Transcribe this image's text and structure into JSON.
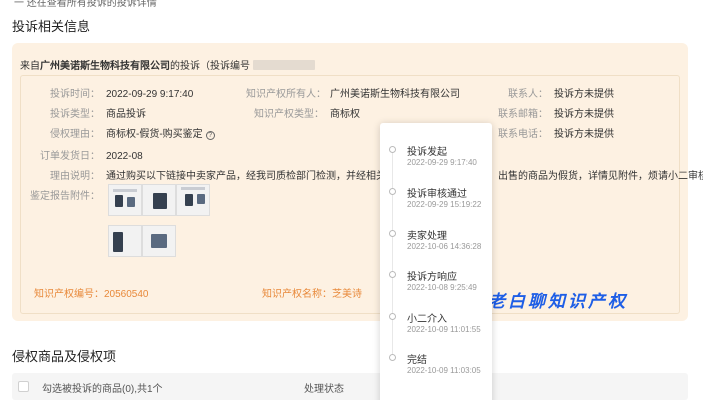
{
  "top_crumb": "一 还在查看所有投诉的投诉详情",
  "section1_title": "投诉相关信息",
  "card": {
    "head_prefix": "来自",
    "company": "广州美诺斯生物科技有限公司",
    "head_suffix": "的投诉（投诉编号",
    "rows": {
      "complaint_time_label": "投诉时间：",
      "complaint_time_value": "2022-09-29 9:17:40",
      "owner_label": "知识产权所有人：",
      "owner_value": "广州美诺斯生物科技有限公司",
      "contact_label": "联系人：",
      "contact_value": "投诉方未提供",
      "type_label": "投诉类型：",
      "type_value": "商品投诉",
      "ip_type_label": "知识产权类型：",
      "ip_type_value": "商标权",
      "email_label": "联系邮箱：",
      "email_value": "投诉方未提供",
      "reason_label": "侵权理由：",
      "reason_value": "商标权-假货-购买鉴定",
      "phone_label": "联系电话：",
      "phone_value": "投诉方未提供",
      "order_date_label": "订单发货日：",
      "order_date_value": "2022-08",
      "explain_label": "理由说明：",
      "explain_value_left": "通过购买以下链接中卖家产品，经我司质检部门检测，并经相关",
      "explain_value_right": "出售的商品为假货，详情见附件，烦请小二审核",
      "report_label": "鉴定报告附件："
    },
    "ip_no_label": "知识产权编号：",
    "ip_no_value": "20560540",
    "ip_name_label": "知识产权名称：",
    "ip_name_value": "芝美诗"
  },
  "timeline": [
    {
      "label": "投诉发起",
      "time": "2022-09-29 9:17:40"
    },
    {
      "label": "投诉审核通过",
      "time": "2022-09-29 15:19:22"
    },
    {
      "label": "卖家处理",
      "time": "2022-10-06 14:36:28"
    },
    {
      "label": "投诉方响应",
      "time": "2022-10-08 9:25:49"
    },
    {
      "label": "小二介入",
      "time": "2022-10-09 11:01:55"
    },
    {
      "label": "完结",
      "time": "2022-10-09 11:03:05"
    }
  ],
  "watermark": "老白聊知识产权",
  "section2_title": "侵权商品及侵权项",
  "table": {
    "select_label": "勾选被投诉的商品(0),共1个",
    "status_header": "处理状态"
  },
  "colors": {
    "card_bg": "#fdf1e2",
    "accent_orange": "#e8893a",
    "watermark_blue": "#1e5ee6"
  }
}
